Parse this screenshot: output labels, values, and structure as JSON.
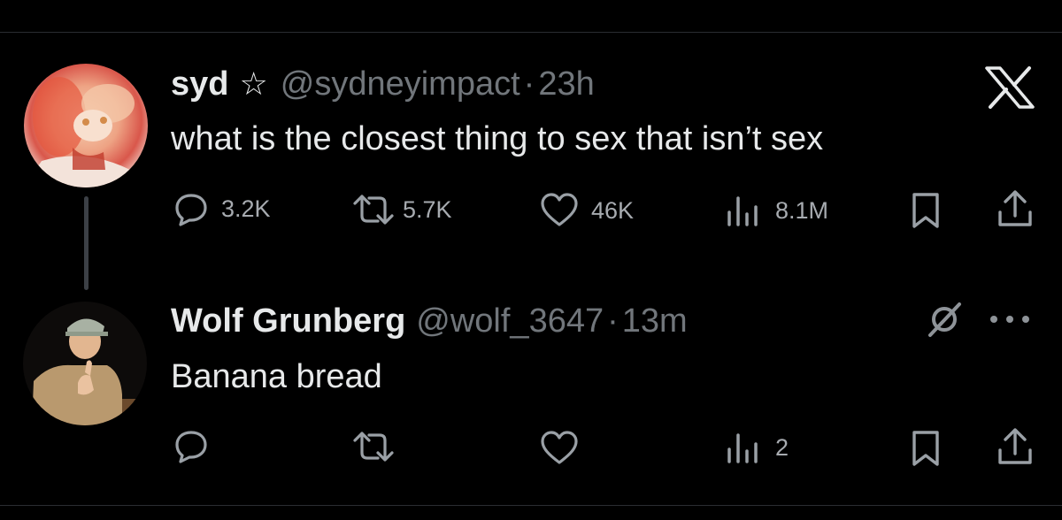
{
  "tweet1": {
    "name": "syd",
    "star": "☆",
    "handle": "@sydneyimpact",
    "separator": "·",
    "time": "23h",
    "text": "what is the closest thing to sex that isn’t sex",
    "replies": "3.2K",
    "reposts": "5.7K",
    "likes": "46K",
    "views": "8.1M",
    "logo_icon": "x-logo-icon"
  },
  "tweet2": {
    "name": "Wolf Grunberg",
    "handle": "@wolf_3647",
    "separator": "·",
    "time": "13m",
    "text": "Banana bread",
    "replies": "",
    "reposts": "",
    "likes": "",
    "views": "2",
    "status_icon": "grok-icon",
    "more_icon": "more-icon"
  },
  "colors": {
    "background": "#000000",
    "text": "#e7e9ea",
    "muted": "#71767b",
    "divider": "#2a2d31"
  }
}
